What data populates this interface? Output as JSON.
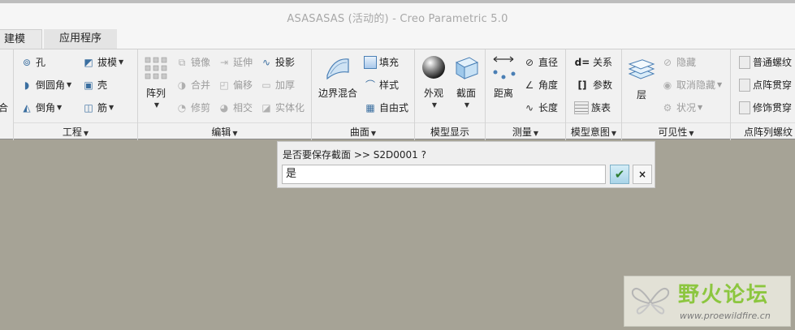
{
  "window": {
    "title": "ASASASAS (活动的) - Creo Parametric 5.0"
  },
  "tabs": [
    {
      "label": "建模"
    },
    {
      "label": "应用程序"
    }
  ],
  "ribbon": {
    "left_partial": {
      "label": "合"
    },
    "engineering": {
      "title": "工程",
      "items": [
        {
          "label": "孔"
        },
        {
          "label": "拔模"
        },
        {
          "label": "倒圆角"
        },
        {
          "label": "壳"
        },
        {
          "label": "倒角"
        },
        {
          "label": "筋"
        }
      ]
    },
    "edit": {
      "title": "编辑",
      "pattern_label": "阵列",
      "items": [
        {
          "label": "镜像"
        },
        {
          "label": "延伸"
        },
        {
          "label": "投影"
        },
        {
          "label": "合并"
        },
        {
          "label": "偏移"
        },
        {
          "label": "加厚"
        },
        {
          "label": "修剪"
        },
        {
          "label": "相交"
        },
        {
          "label": "实体化"
        }
      ]
    },
    "surface": {
      "title": "曲面",
      "boundary_blend_label": "边界混合",
      "items": [
        {
          "label": "填充"
        },
        {
          "label": "样式"
        },
        {
          "label": "自由式"
        }
      ]
    },
    "model_display": {
      "title": "模型显示",
      "appearance_label": "外观",
      "section_label": "截面"
    },
    "measure": {
      "title": "测量",
      "distance_label": "距离",
      "items": [
        {
          "label": "直径"
        },
        {
          "label": "角度"
        },
        {
          "label": "长度"
        }
      ]
    },
    "model_intent": {
      "title": "模型意图",
      "items": [
        {
          "label": "关系",
          "icon_text": "d="
        },
        {
          "label": "参数",
          "icon_text": "[]"
        },
        {
          "label": "族表"
        }
      ]
    },
    "visibility": {
      "title": "可见性",
      "layer_label": "层",
      "items": [
        {
          "label": "隐藏"
        },
        {
          "label": "取消隐藏"
        },
        {
          "label": "状况"
        }
      ]
    },
    "thread": {
      "title": "点阵列螺纹",
      "items": [
        {
          "label": "普通螺纹"
        },
        {
          "label": "点阵贯穿"
        },
        {
          "label": "修饰贯穿"
        }
      ]
    }
  },
  "prompt": {
    "message": "是否要保存截面 >> S2D0001 ?",
    "value": "是",
    "ok_symbol": "✔",
    "cancel_symbol": "×"
  },
  "watermark": {
    "brand": "野火论坛",
    "url": "www.proewildfire.cn"
  },
  "colors": {
    "canvas": "#a6a396",
    "ribbon": "#f1f1f1",
    "accent_blue": "#4a7fb5",
    "watermark_green": "#8cc63f"
  }
}
